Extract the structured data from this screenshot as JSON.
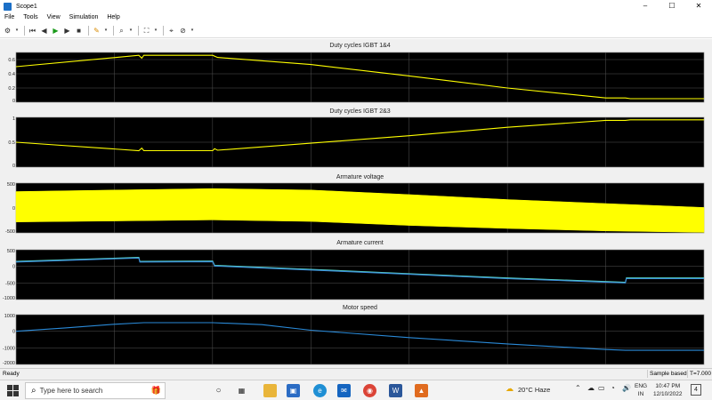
{
  "window": {
    "title": "Scope1",
    "controls": [
      "–",
      "☐",
      "✕"
    ]
  },
  "menu": [
    "File",
    "Tools",
    "View",
    "Simulation",
    "Help"
  ],
  "toolbar": {
    "icons": [
      "gear-icon",
      "rewind-icon",
      "step-back-icon",
      "run-icon",
      "step-forward-icon",
      "stop-icon",
      "highlight-icon",
      "zoom-icon",
      "fit-icon",
      "cursor-icon",
      "triggers-icon"
    ]
  },
  "chart_data": [
    {
      "type": "line",
      "title": "Duty cycles IGBT 1&4",
      "ylim": [
        0,
        0.7
      ],
      "yticks": [
        "0",
        "0.2",
        "0.4",
        "0.6"
      ],
      "ytick_values": [
        0,
        0.2,
        0.4,
        0.6
      ],
      "color": "#ffff00",
      "x": [
        0,
        1.25,
        1.28,
        1.3,
        2.0,
        2.05,
        3.0,
        4.0,
        5.0,
        6.0,
        6.2,
        6.25,
        7.0
      ],
      "y": [
        0.5,
        0.66,
        0.62,
        0.66,
        0.66,
        0.63,
        0.53,
        0.37,
        0.2,
        0.06,
        0.06,
        0.05,
        0.05
      ]
    },
    {
      "type": "line",
      "title": "Duty cycles IGBT 2&3",
      "ylim": [
        0,
        1
      ],
      "yticks": [
        "0",
        "0.5",
        "1"
      ],
      "ytick_values": [
        0,
        0.5,
        1
      ],
      "color": "#ffff00",
      "x": [
        0,
        1.25,
        1.28,
        1.3,
        2.0,
        2.02,
        2.05,
        3.0,
        4.0,
        5.0,
        6.0,
        6.2,
        6.25,
        7.0
      ],
      "y": [
        0.5,
        0.33,
        0.38,
        0.33,
        0.33,
        0.37,
        0.34,
        0.48,
        0.63,
        0.8,
        0.94,
        0.94,
        0.95,
        0.95
      ]
    },
    {
      "type": "area",
      "title": "Armature voltage",
      "ylim": [
        -500,
        500
      ],
      "yticks": [
        "-500",
        "0",
        "500"
      ],
      "ytick_values": [
        -500,
        0,
        500
      ],
      "color": "#ffff00",
      "x": [
        0,
        1,
        2,
        3,
        4,
        5,
        6,
        7
      ],
      "upper": [
        330,
        360,
        390,
        360,
        270,
        170,
        90,
        10
      ],
      "lower": [
        -280,
        -260,
        -240,
        -270,
        -350,
        -410,
        -460,
        -490
      ]
    },
    {
      "type": "line",
      "title": "Armature current",
      "ylim": [
        -1000,
        500
      ],
      "yticks": [
        "-1000",
        "-500",
        "0",
        "500"
      ],
      "ytick_values": [
        -1000,
        -500,
        0,
        500
      ],
      "series": [
        {
          "color": "#5ad8c8",
          "x": [
            0,
            1.25,
            1.26,
            2.0,
            2.02,
            3.0,
            4.0,
            5.0,
            6.2,
            6.21,
            7.0
          ],
          "y": [
            150,
            270,
            150,
            160,
            30,
            -90,
            -220,
            -350,
            -480,
            -350,
            -350
          ]
        },
        {
          "color": "#3a8ad8",
          "x": [
            0,
            1.25,
            1.26,
            2.0,
            2.02,
            3.0,
            4.0,
            5.0,
            6.2,
            6.21,
            7.0
          ],
          "y": [
            130,
            250,
            130,
            140,
            10,
            -110,
            -240,
            -370,
            -500,
            -370,
            -370
          ]
        }
      ]
    },
    {
      "type": "line",
      "title": "Motor speed",
      "ylim": [
        -2000,
        1000
      ],
      "yticks": [
        "-2000",
        "-1000",
        "0",
        "1000"
      ],
      "ytick_values": [
        -2000,
        -1000,
        0,
        1000
      ],
      "color": "#2a8ad8",
      "x": [
        0,
        0.5,
        1.0,
        1.3,
        2.0,
        2.5,
        3.0,
        4.0,
        5.0,
        6.0,
        6.2,
        7.0
      ],
      "y": [
        0,
        200,
        420,
        520,
        520,
        400,
        60,
        -380,
        -760,
        -1100,
        -1150,
        -1150
      ]
    }
  ],
  "xticks": [
    "0",
    "1",
    "2",
    "3",
    "4",
    "5",
    "6",
    "7"
  ],
  "xtick_values": [
    0,
    1,
    2,
    3,
    4,
    5,
    6,
    7
  ],
  "status": {
    "ready": "Ready",
    "sample": "Sample based",
    "time": "T=7.000"
  },
  "taskbar": {
    "search_placeholder": "Type here to search",
    "weather": "20°C  Haze",
    "lang": "ENG",
    "region": "IN",
    "clock": "10:47 PM",
    "date": "12/10/2022",
    "notifications": "4"
  }
}
